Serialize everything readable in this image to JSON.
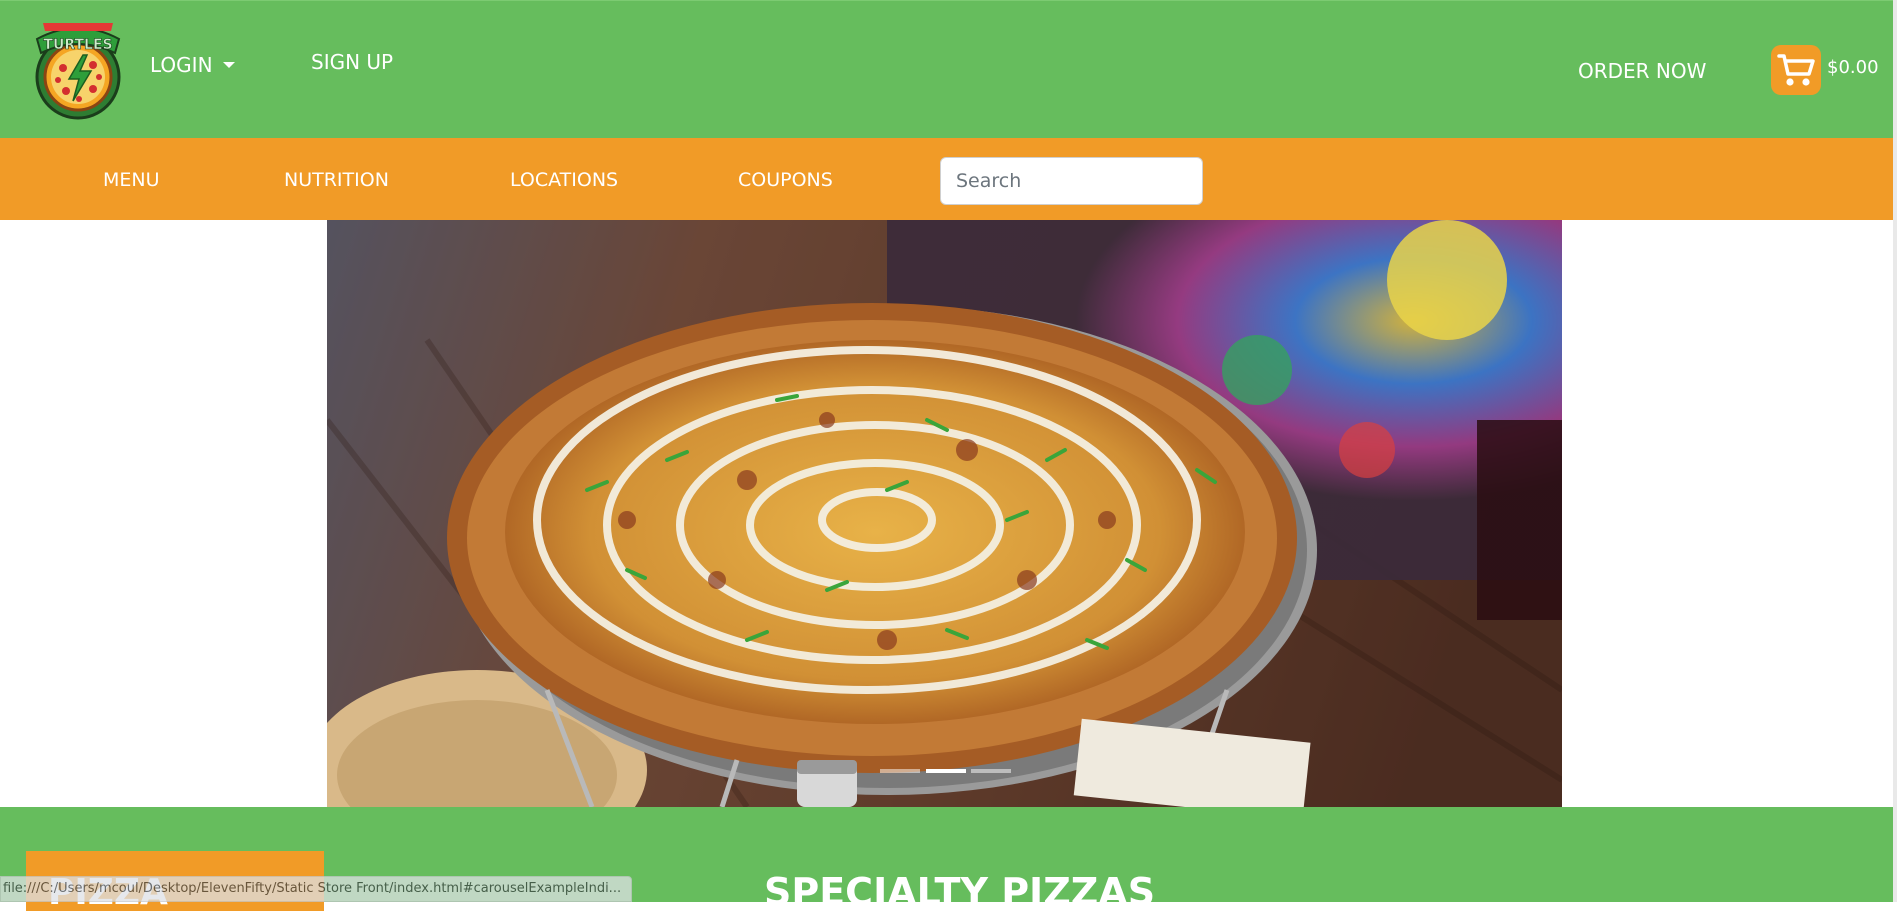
{
  "brand": {
    "logo_text": "TURTLES",
    "colors": {
      "green": "#66bd5d",
      "orange": "#f19b27",
      "white": "#ffffff"
    }
  },
  "header": {
    "login_label": "LOGIN",
    "signup_label": "SIGN UP",
    "order_now_label": "ORDER NOW",
    "cart_total": "$0.00",
    "cart_icon": "shopping-cart-icon"
  },
  "nav": {
    "items": [
      {
        "label": "MENU"
      },
      {
        "label": "NUTRITION"
      },
      {
        "label": "LOCATIONS"
      },
      {
        "label": "COUPONS"
      }
    ],
    "search_placeholder": "Search"
  },
  "carousel": {
    "image": "pizza-photo",
    "indicator_count": 3,
    "active_index": 1
  },
  "section": {
    "category_label": "PIZZA",
    "title": "SPECIALTY PIZZAS"
  },
  "status_bar": {
    "url": "file:///C:/Users/mcoul/Desktop/ElevenFifty/Static Store Front/index.html#carouselExampleIndi..."
  }
}
